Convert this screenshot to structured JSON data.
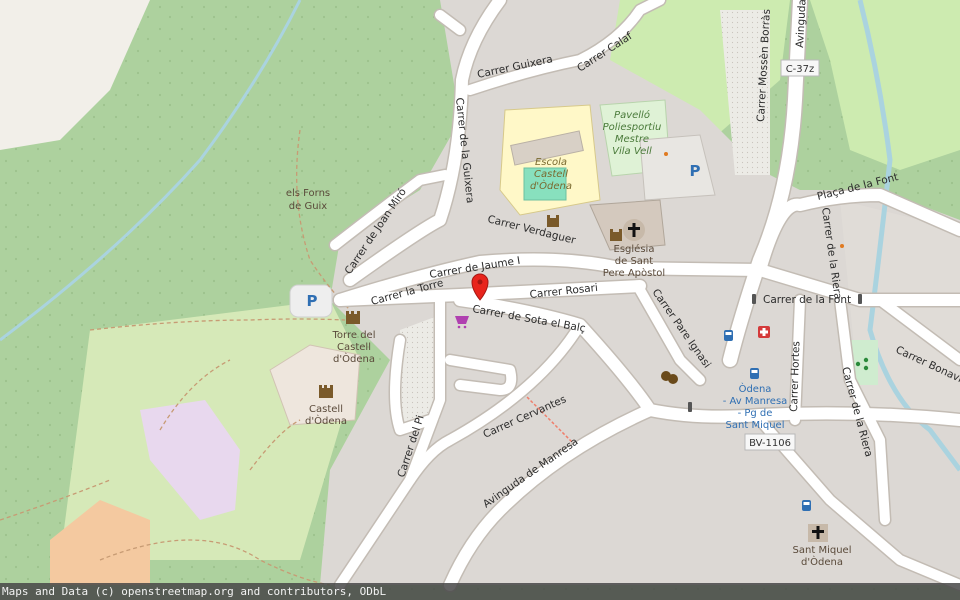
{
  "map": {
    "attribution": "Maps and Data (c) openstreetmap.org and contributors, ODbL",
    "streets": {
      "guixera": "Carrer Guixera",
      "calaf": "Carrer Calaf",
      "de_la_guixera": "Carrer de la Guixera",
      "mossen_borras": "Carrer Mossèn Borràs",
      "avinguda": "Avinguda",
      "joan_miro": "Carrer de Joan Miró",
      "verdaguer": "Carrer Verdaguer",
      "jaume_i": "Carrer de Jaume I",
      "la_torre": "Carrer la Torre",
      "rosari": "Carrer Rosari",
      "sota_el_balc": "Carrer de Sota el Balç",
      "pare_ignasi": "Carrer Pare Ignasi",
      "de_la_font": "Carrer de la Font",
      "placa_font": "Plaça de la Font",
      "de_la_riera": "Carrer de la Riera",
      "de_la_riera_2": "Carrer de la Riera",
      "hortes": "Carrer Hortes",
      "cervantes": "Carrer Cervantes",
      "avinguda_manresa": "Avinguda de Manresa",
      "del_pi": "Carrer del Pi",
      "bonavista": "Carrer Bonavista",
      "c37z": "C-37z",
      "bv1106": "BV-1106"
    },
    "places": {
      "els_forns_1": "els Forns",
      "els_forns_2": "de Guix",
      "escola_1": "Escola",
      "escola_2": "Castell",
      "escola_3": "d'Òdena",
      "pavello_1": "Pavelló",
      "pavello_2": "Poliesportiu",
      "pavello_3": "Mestre",
      "pavello_4": "Vila Vell",
      "esglesia_1": "Església",
      "esglesia_2": "de Sant",
      "esglesia_3": "Pere Apòstol",
      "torre_1": "Torre del",
      "torre_2": "Castell",
      "torre_3": "d'Òdena",
      "castell_1": "Castell",
      "castell_2": "d'Òdena",
      "bus_1": "Òdena",
      "bus_2": "- Av Manresa",
      "bus_3": "- Pg de",
      "bus_4": "Sant Miquel",
      "sant_miquel_1": "Sant Miquel",
      "sant_miquel_2": "d'Òdena",
      "parking": "P"
    },
    "colors": {
      "forest": "#add19e",
      "park": "#c8e6b4",
      "road": "#ffffff",
      "area": "#dcd8d4",
      "water": "#aad3df",
      "school": "#fff8c8",
      "marker": "#e8241c"
    },
    "icons": [
      "marker-icon",
      "parking-icon",
      "castle-icon",
      "church-icon",
      "pharmacy-icon",
      "bus-stop-icon",
      "theatre-icon",
      "shop-icon",
      "playground-icon",
      "traffic-signal-icon"
    ]
  }
}
